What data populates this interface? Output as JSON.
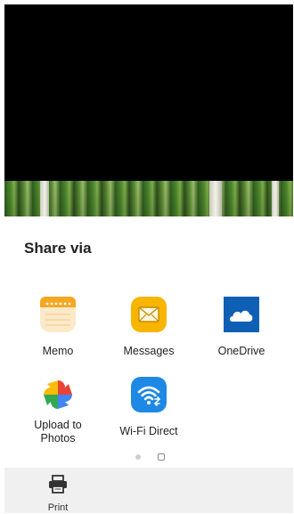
{
  "sheet": {
    "title": "Share via",
    "apps": [
      {
        "label": "Memo",
        "icon": "memo-icon"
      },
      {
        "label": "Messages",
        "icon": "messages-icon"
      },
      {
        "label": "OneDrive",
        "icon": "onedrive-icon"
      },
      {
        "label": "Upload to\nPhotos",
        "icon": "google-photos-icon"
      },
      {
        "label": "Wi-Fi Direct",
        "icon": "wifi-direct-icon"
      }
    ],
    "pager": {
      "current_page": 1,
      "page_count": 2
    }
  },
  "bottom": {
    "print_label": "Print",
    "print_icon": "printer-icon"
  },
  "colors": {
    "sheet_bg": "#ffffff",
    "bottom_bar_bg": "#f0f0f0",
    "memo": "#f5a623",
    "messages": "#f7b500",
    "onedrive": "#0f5fb4",
    "wifi_direct": "#1e88e5"
  }
}
